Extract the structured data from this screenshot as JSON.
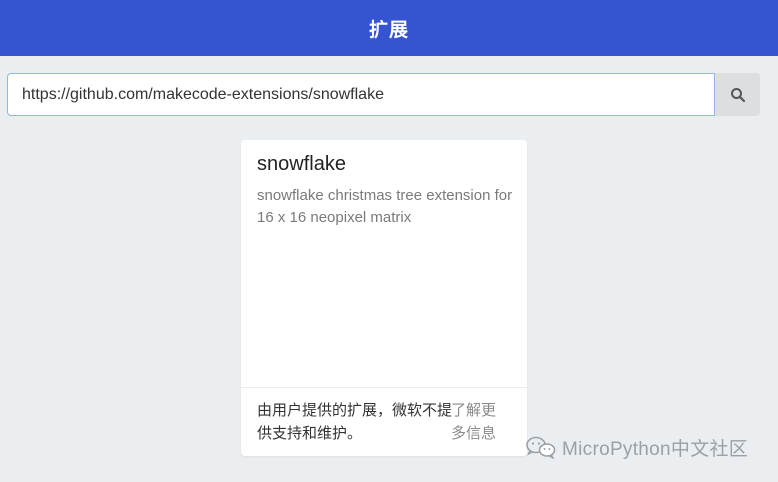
{
  "header": {
    "title": "扩展"
  },
  "search": {
    "value": "https://github.com/makecode-extensions/snowflake",
    "button_icon": "search-icon"
  },
  "card": {
    "title": "snowflake",
    "description": "snowflake christmas tree extension for 16 x 16 neopixel matrix",
    "note": "由用户提供的扩展，微软不提供支持和维护。",
    "learn_more": "了解更多信息"
  },
  "watermark": {
    "text": "MicroPython中文社区",
    "icon": "wechat-icon"
  },
  "colors": {
    "header": "#3454d1",
    "background": "#ebeef0",
    "input_border": "#8fb6e6"
  }
}
